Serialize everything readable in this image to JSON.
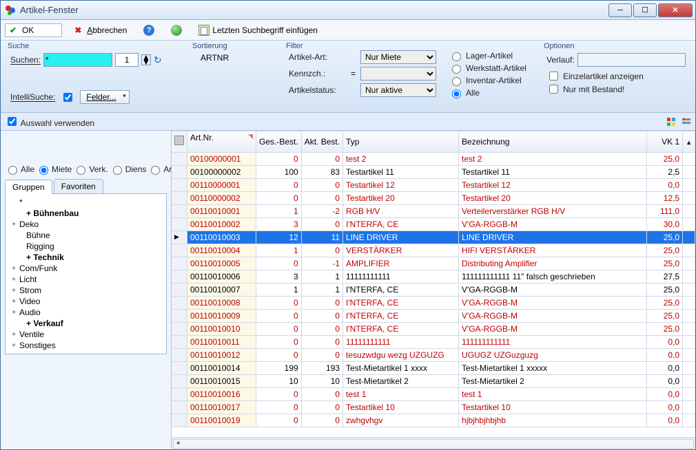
{
  "window": {
    "title": "Artikel-Fenster"
  },
  "toolbar": {
    "ok": "OK",
    "abbrechen": "Abbrechen",
    "letzten": "Letzten Suchbegriff einfügen"
  },
  "suche": {
    "legend": "Suche",
    "label": "Suchen:",
    "value": "*",
    "spin": "1",
    "intelli_label": "IntelliSuche:",
    "intelli_checked": true,
    "felder": "Felder..."
  },
  "sortierung": {
    "legend": "Sortierung",
    "value": "ARTNR"
  },
  "filter": {
    "legend": "Filter",
    "art_label": "Artikel-Art:",
    "art_value": "Nur Miete",
    "kennz_label": "Kennzch.:",
    "kennz_eq": "=",
    "kennz_value": "",
    "status_label": "Artikelstatus:",
    "status_value": "Nur aktive",
    "radios": {
      "lager": "Lager-Artikel",
      "werkstatt": "Werkstatt-Artikel",
      "inventar": "Inventar-Artikel",
      "alle": "Alle",
      "selected": "alle"
    }
  },
  "optionen": {
    "legend": "Optionen",
    "verlauf_label": "Verlauf:",
    "verlauf_value": "",
    "einzel": "Einzelartikel anzeigen",
    "bestand": "Nur mit Bestand!"
  },
  "auswahl": {
    "label": "Auswahl verwenden",
    "checked": true
  },
  "scope": {
    "alle": "Alle",
    "miete": "Miete",
    "verk": "Verk.",
    "diens": "Diens",
    "arb": "Arb.",
    "selected": "miete"
  },
  "tabs": {
    "gruppen": "Gruppen",
    "favoriten": "Favoriten",
    "active": "gruppen"
  },
  "tree": [
    {
      "label": "*",
      "exp": "",
      "bold": false,
      "indent": 0
    },
    {
      "label": "+ Bühnenbau",
      "exp": "",
      "bold": true,
      "indent": 1
    },
    {
      "label": "Deko",
      "exp": "+",
      "bold": false,
      "indent": 0
    },
    {
      "label": "Bühne",
      "exp": "",
      "bold": false,
      "indent": 1
    },
    {
      "label": "Rigging",
      "exp": "",
      "bold": false,
      "indent": 1
    },
    {
      "label": "+ Technik",
      "exp": "",
      "bold": true,
      "indent": 1
    },
    {
      "label": "Com/Funk",
      "exp": "+",
      "bold": false,
      "indent": 0
    },
    {
      "label": "Licht",
      "exp": "+",
      "bold": false,
      "indent": 0
    },
    {
      "label": "Strom",
      "exp": "+",
      "bold": false,
      "indent": 0
    },
    {
      "label": "Video",
      "exp": "+",
      "bold": false,
      "indent": 0
    },
    {
      "label": "Audio",
      "exp": "+",
      "bold": false,
      "indent": 0
    },
    {
      "label": "+ Verkauf",
      "exp": "",
      "bold": true,
      "indent": 1
    },
    {
      "label": "Ventile",
      "exp": "+",
      "bold": false,
      "indent": 0
    },
    {
      "label": "Sonstiges",
      "exp": "+",
      "bold": false,
      "indent": 0
    }
  ],
  "grid": {
    "headers": {
      "artnr": "Art.Nr.",
      "ges": "Ges.-Best.",
      "akt": "Akt. Best.",
      "typ": "Typ",
      "bez": "Bezeichnung",
      "vk": "VK 1"
    },
    "selected_index": 6,
    "rows": [
      {
        "c": "red",
        "artnr": "00100000001",
        "ges": "0",
        "akt": "0",
        "typ": "test 2",
        "bez": "test 2",
        "vk": "25,0"
      },
      {
        "c": "black",
        "artnr": "00100000002",
        "ges": "100",
        "akt": "83",
        "typ": "Testartikel 11",
        "bez": "Testartikel 11",
        "vk": "2,5"
      },
      {
        "c": "red",
        "artnr": "00110000001",
        "ges": "0",
        "akt": "0",
        "typ": "Testartikel 12",
        "bez": "Testartikel 12",
        "vk": "0,0"
      },
      {
        "c": "red",
        "artnr": "00110000002",
        "ges": "0",
        "akt": "0",
        "typ": "Testartikel 20",
        "bez": "Testartikel 20",
        "vk": "12,5"
      },
      {
        "c": "red",
        "artnr": "00110010001",
        "ges": "1",
        "akt": "-2",
        "typ": "RGB H/V",
        "bez": "Verteilerverstärker RGB H/V",
        "vk": "111,0"
      },
      {
        "c": "red",
        "artnr": "00110010002",
        "ges": "3",
        "akt": "0",
        "typ": "I'NTERFA, CE",
        "bez": "V'GA-RGGB-M",
        "vk": "30,0"
      },
      {
        "c": "black",
        "artnr": "00110010003",
        "ges": "12",
        "akt": "11",
        "typ": "LINE DRIVER",
        "bez": "LINE DRIVER",
        "vk": "25,0"
      },
      {
        "c": "red",
        "artnr": "00110010004",
        "ges": "1",
        "akt": "0",
        "typ": "VERSTÄRKER",
        "bez": "HIFI VERSTÄRKER",
        "vk": "25,0"
      },
      {
        "c": "red",
        "artnr": "00110010005",
        "ges": "0",
        "akt": "-1",
        "typ": "AMPLIFIER",
        "bez": "Distributing Amplifier",
        "vk": "25,0"
      },
      {
        "c": "black",
        "artnr": "00110010006",
        "ges": "3",
        "akt": "1",
        "typ": "11111111111",
        "bez": "111111111111 11\" falsch geschrieben",
        "vk": "27,5"
      },
      {
        "c": "black",
        "artnr": "00110010007",
        "ges": "1",
        "akt": "1",
        "typ": "I'NTERFA, CE",
        "bez": "V'GA-RGGB-M",
        "vk": "25,0"
      },
      {
        "c": "red",
        "artnr": "00110010008",
        "ges": "0",
        "akt": "0",
        "typ": "I'NTERFA, CE",
        "bez": "V'GA-RGGB-M",
        "vk": "25,0"
      },
      {
        "c": "red",
        "artnr": "00110010009",
        "ges": "0",
        "akt": "0",
        "typ": "I'NTERFA, CE",
        "bez": "V'GA-RGGB-M",
        "vk": "25,0"
      },
      {
        "c": "red",
        "artnr": "00110010010",
        "ges": "0",
        "akt": "0",
        "typ": "I'NTERFA, CE",
        "bez": "V'GA-RGGB-M",
        "vk": "25,0"
      },
      {
        "c": "red",
        "artnr": "00110010011",
        "ges": "0",
        "akt": "0",
        "typ": "11111111111",
        "bez": "111111111111",
        "vk": "0,0"
      },
      {
        "c": "red",
        "artnr": "00110010012",
        "ges": "0",
        "akt": "0",
        "typ": "tesuzwdgu wezg UZGUZG",
        "bez": "UGUGZ UZGuzguzg",
        "vk": "0,0"
      },
      {
        "c": "black",
        "artnr": "00110010014",
        "ges": "199",
        "akt": "193",
        "typ": "Test-Mietartikel 1 xxxx",
        "bez": "Test-Mietartikel 1 xxxxx",
        "vk": "0,0"
      },
      {
        "c": "black",
        "artnr": "00110010015",
        "ges": "10",
        "akt": "10",
        "typ": "Test-Mietartikel 2",
        "bez": "Test-Mietartikel 2",
        "vk": "0,0"
      },
      {
        "c": "red",
        "artnr": "00110010016",
        "ges": "0",
        "akt": "0",
        "typ": "test 1",
        "bez": "test 1",
        "vk": "0,0"
      },
      {
        "c": "red",
        "artnr": "00110010017",
        "ges": "0",
        "akt": "0",
        "typ": "Testartikel 10",
        "bez": "Testartikel 10",
        "vk": "0,0"
      },
      {
        "c": "red",
        "artnr": "00110010019",
        "ges": "0",
        "akt": "0",
        "typ": "zwhgvhgv",
        "bez": "hjbjhbjhbjhb",
        "vk": "0,0"
      }
    ]
  }
}
